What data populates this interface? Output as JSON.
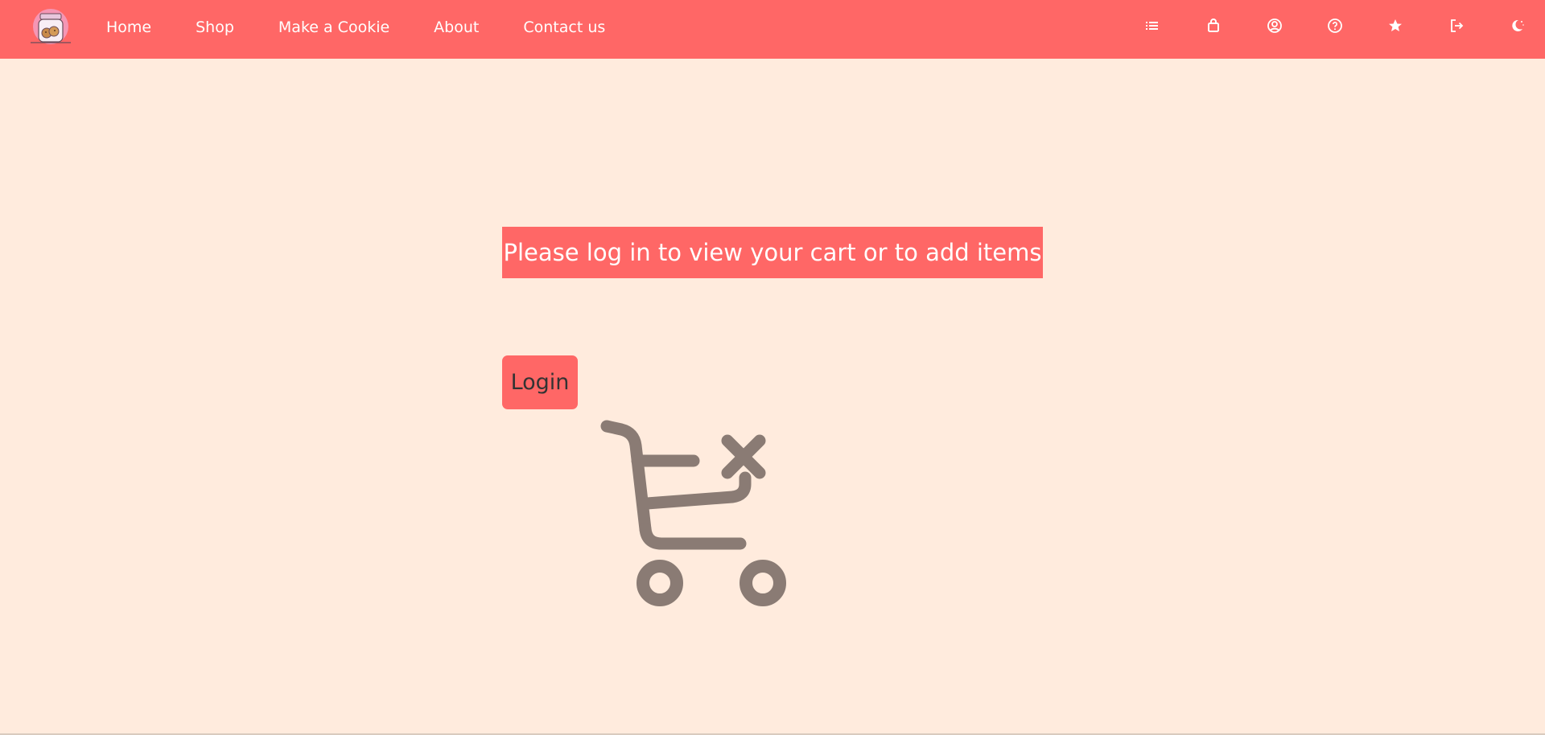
{
  "nav": {
    "links": [
      "Home",
      "Shop",
      "Make a Cookie",
      "About",
      "Contact us"
    ],
    "icons": [
      "list-icon",
      "shopping-bag-icon",
      "user-icon",
      "help-icon",
      "star-icon",
      "logout-icon",
      "dark-mode-icon"
    ]
  },
  "main": {
    "message": "Please log in to view your cart or to add items",
    "login_label": "Login",
    "illustration": "empty-cart-icon"
  },
  "colors": {
    "primary": "#FF6766",
    "background": "#FFEBDD",
    "illustration": "#8A7B74"
  }
}
